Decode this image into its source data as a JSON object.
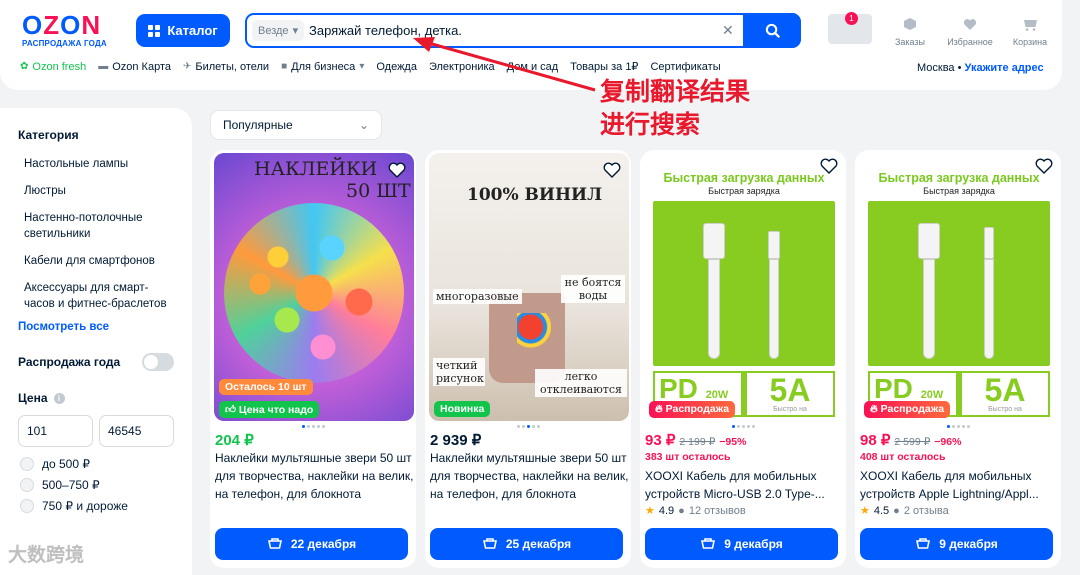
{
  "header": {
    "logo": "OZON",
    "logo_sub": "РАСПРОДАЖА ГОДА",
    "catalog_label": "Каталог",
    "search_scope": "Везде",
    "search_query": "Заряжай телефон, детка.",
    "notif_count": "1",
    "orders_label": "Заказы",
    "favorites_label": "Избранное",
    "cart_label": "Корзина"
  },
  "subnav": {
    "items": [
      "Ozon fresh",
      "Ozon Карта",
      "Билеты, отели",
      "Для бизнеса",
      "Одежда",
      "Электроника",
      "Дом и сад",
      "Товары за 1₽",
      "Сертификаты"
    ],
    "city": "Москва",
    "address_link": "Укажите адрес"
  },
  "annotation": {
    "line1": "复制翻译结果",
    "line2": "进行搜索"
  },
  "sidebar": {
    "category_title": "Категория",
    "categories": [
      "Настольные лампы",
      "Люстры",
      "Настенно-потолочные светильники",
      "Кабели для смартфонов",
      "Аксессуары для смарт-часов и фитнес-браслетов"
    ],
    "see_all": "Посмотреть все",
    "sale_label": "Распродажа года",
    "price_title": "Цена",
    "price_from": "101",
    "price_to": "46545",
    "ranges": [
      "до 500 ₽",
      "500–750 ₽",
      "750 ₽ и дороже"
    ],
    "watermark": "大数跨境"
  },
  "sort": {
    "selected": "Популярные"
  },
  "products": [
    {
      "image_text_1": "НАКЛЕЙКИ",
      "image_text_2": "50 ШТ",
      "tag1": "Осталось 10 шт",
      "tag2": "Цена что надо",
      "price": "204 ₽",
      "title": "Наклейки мультяшные звери 50 шт для творчества, наклейки на велик, на телефон, для блокнота",
      "delivery": "22 декабря"
    },
    {
      "image_text_1": "100% ВИНИЛ",
      "label_a": "многоразовые",
      "label_b": "не боятся воды",
      "label_c": "четкий рисунок",
      "label_d": "легко отклеиваются",
      "tag": "Новинка",
      "price": "2 939 ₽",
      "title": "Наклейки мультяшные звери 50 шт для творчества, наклейки на велик, на телефон, для блокнота",
      "delivery": "25 декабря"
    },
    {
      "image_head": "Быстрая загрузка данных",
      "image_sub": "Быстрая зарядка",
      "pd": "PD",
      "pd_w": "20W",
      "amp": "5A",
      "amp_sub": "Быстро на",
      "tag": "Распродажа",
      "price": "93 ₽",
      "old_price": "2 199 ₽",
      "discount": "−95%",
      "left": "383 шт осталось",
      "title": "XOOXI Кабель для мобильных устройств Micro-USB 2.0 Type-...",
      "rating": "4.9",
      "reviews": "12 отзывов",
      "delivery": "9 декабря"
    },
    {
      "image_head": "Быстрая загрузка данных",
      "image_sub": "Быстрая зарядка",
      "pd": "PD",
      "pd_w": "20W",
      "amp": "5A",
      "amp_sub": "Быстро на",
      "tag": "Распродажа",
      "price": "98 ₽",
      "old_price": "2 599 ₽",
      "discount": "−96%",
      "left": "408 шт осталось",
      "title": "XOOXI Кабель для мобильных устройств Apple Lightning/Appl...",
      "rating": "4.5",
      "reviews": "2 отзыва",
      "delivery": "9 декабря"
    }
  ],
  "colors": {
    "brand": "#005bff",
    "accent": "#f91155",
    "green": "#10c44c",
    "annotation": "#e8192c"
  }
}
